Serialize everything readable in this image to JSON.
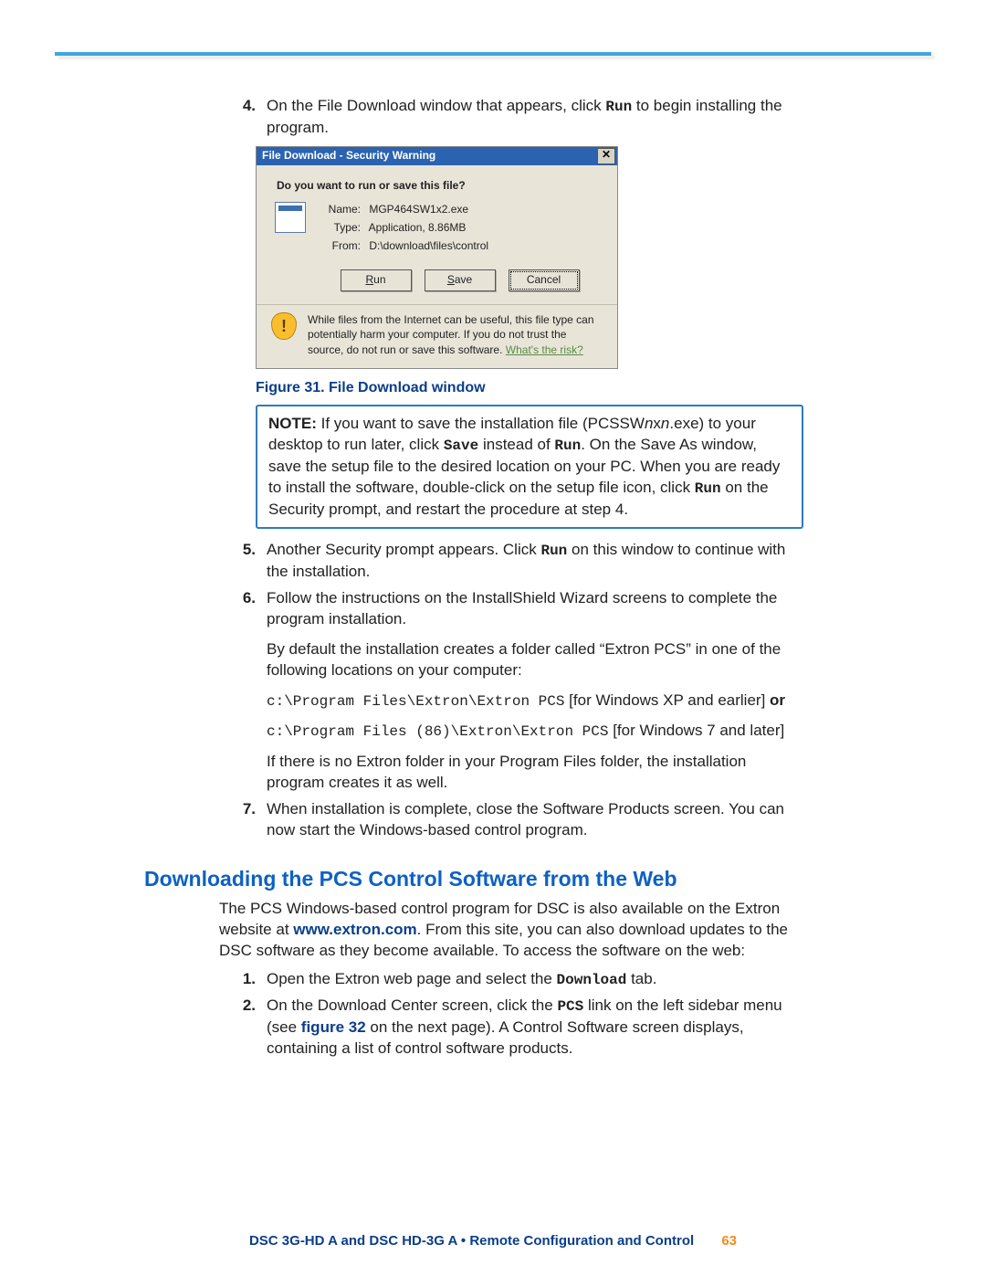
{
  "step4": {
    "num": "4.",
    "t1": "On the File Download window that appears, click ",
    "run": "Run",
    "t2": " to begin installing the program."
  },
  "dialog": {
    "title": "File Download - Security Warning",
    "question": "Do you want to run or save this file?",
    "name_label": "Name:",
    "name_value": "MGP464SW1x2.exe",
    "type_label": "Type:",
    "type_value": "Application, 8.86MB",
    "from_label": "From:",
    "from_value": "D:\\download\\files\\control",
    "btn_run": "Run",
    "btn_save": "Save",
    "btn_cancel": "Cancel",
    "warn": "While files from the Internet can be useful, this file type can potentially harm your computer. If you do not trust the source, do not run or save this software. ",
    "warn_link": "What's the risk?"
  },
  "figure_caption": "Figure 31.  File Download window",
  "note": {
    "label": "NOTE:",
    "t1": "  If you want to save the installation file (PCSSW",
    "it1": "n",
    "t1b": "x",
    "it2": "n",
    "t1c": ".exe) to your desktop to run later, click ",
    "save": "Save",
    "t2": " instead of ",
    "run": "Run",
    "t3": ". On the Save As window, save the setup file to the desired location on your PC. When you are ready to install the software, double-click on the setup file icon, click ",
    "run2": "Run",
    "t4": " on the Security prompt, and restart the procedure at step 4."
  },
  "step5": {
    "num": "5.",
    "t1": "Another Security prompt appears. Click ",
    "run": "Run",
    "t2": " on this window to continue with the installation."
  },
  "step6": {
    "num": "6.",
    "t1": "Follow the instructions on the InstallShield Wizard screens to complete the program installation.",
    "p1": "By default the installation creates a folder called “Extron PCS” in one of the following locations on your computer:",
    "path1": "c:\\Program Files\\Extron\\Extron PCS",
    "p1suffix": " [for Windows XP and earlier] ",
    "or": "or",
    "path2": "c:\\Program Files (86)\\Extron\\Extron PCS",
    "p2suffix": " [for Windows 7 and later]",
    "p3": "If there is no Extron folder in your Program Files folder, the installation program creates it as well."
  },
  "step7": {
    "num": "7.",
    "t1": "When installation is complete, close the Software Products screen. You can now start the Windows-based control program."
  },
  "section_h": "Downloading the PCS Control Software from the Web",
  "section_p": {
    "t1": "The PCS Windows-based control program for DSC is also available on the Extron website at ",
    "url": "www.extron.com",
    "t2": ". From this site, you can also download updates to the DSC software as they become available. To access the software on the web:"
  },
  "web1": {
    "num": "1.",
    "t1": "Open the Extron web page and select the ",
    "dl": "Download",
    "t2": " tab."
  },
  "web2": {
    "num": "2.",
    "t1": "On the Download Center screen, click the ",
    "pcs": "PCS",
    "t2": " link on the left sidebar menu (see ",
    "fig": "figure 32",
    "t3": " on the next page). A Control Software screen displays, containing a list of control software products."
  },
  "footer": {
    "text": "DSC 3G-HD A and DSC HD-3G A • Remote Configuration and Control",
    "page": "63"
  }
}
